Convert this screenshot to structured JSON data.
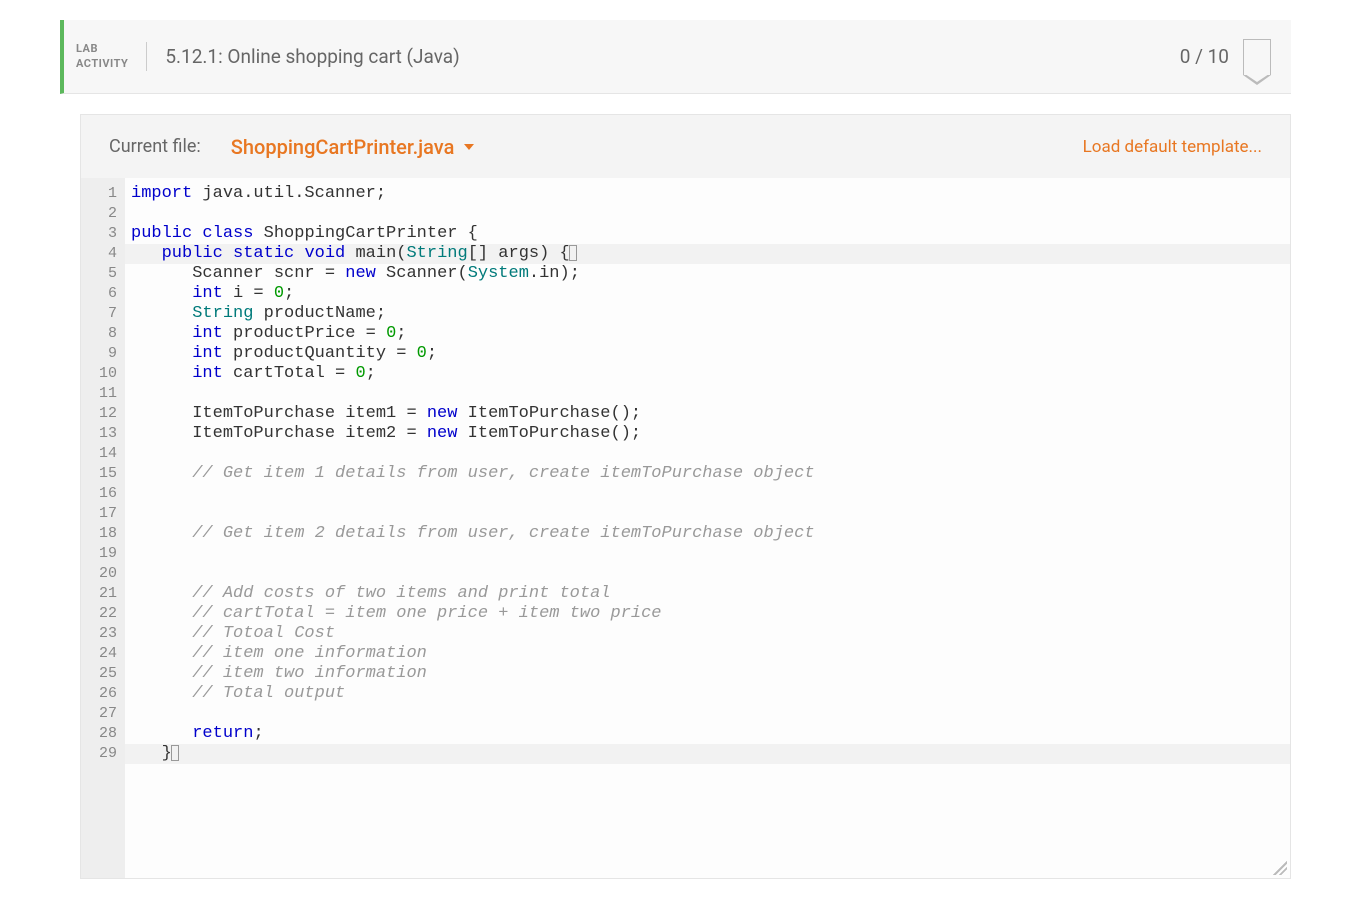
{
  "header": {
    "lab_line1": "LAB",
    "lab_line2": "ACTIVITY",
    "title": "5.12.1: Online shopping cart (Java)",
    "score": "0 / 10"
  },
  "filebar": {
    "current_file_label": "Current file:",
    "file_name": "ShoppingCartPrinter.java",
    "load_template": "Load default template..."
  },
  "code": {
    "lines": [
      {
        "n": 1,
        "t": [
          [
            "kw",
            "import"
          ],
          [
            "",
            " java.util.Scanner;"
          ]
        ]
      },
      {
        "n": 2,
        "t": []
      },
      {
        "n": 3,
        "t": [
          [
            "kw",
            "public"
          ],
          [
            "",
            " "
          ],
          [
            "kw",
            "class"
          ],
          [
            "",
            " ShoppingCartPrinter {"
          ]
        ]
      },
      {
        "n": 4,
        "t": [
          [
            "",
            "   "
          ],
          [
            "kw",
            "public"
          ],
          [
            "",
            " "
          ],
          [
            "kw",
            "static"
          ],
          [
            "",
            " "
          ],
          [
            "kw",
            "void"
          ],
          [
            "",
            " main("
          ],
          [
            "type",
            "String"
          ],
          [
            "",
            "[] args) {"
          ]
        ],
        "hl": true,
        "cursor": true
      },
      {
        "n": 5,
        "t": [
          [
            "",
            "      Scanner scnr = "
          ],
          [
            "kw",
            "new"
          ],
          [
            "",
            " Scanner("
          ],
          [
            "type",
            "System"
          ],
          [
            "",
            ".in);"
          ]
        ]
      },
      {
        "n": 6,
        "t": [
          [
            "",
            "      "
          ],
          [
            "kw",
            "int"
          ],
          [
            "",
            " i = "
          ],
          [
            "num",
            "0"
          ],
          [
            "",
            ";"
          ]
        ]
      },
      {
        "n": 7,
        "t": [
          [
            "",
            "      "
          ],
          [
            "type",
            "String"
          ],
          [
            "",
            " productName;"
          ]
        ]
      },
      {
        "n": 8,
        "t": [
          [
            "",
            "      "
          ],
          [
            "kw",
            "int"
          ],
          [
            "",
            " productPrice = "
          ],
          [
            "num",
            "0"
          ],
          [
            "",
            ";"
          ]
        ]
      },
      {
        "n": 9,
        "t": [
          [
            "",
            "      "
          ],
          [
            "kw",
            "int"
          ],
          [
            "",
            " productQuantity = "
          ],
          [
            "num",
            "0"
          ],
          [
            "",
            ";"
          ]
        ]
      },
      {
        "n": 10,
        "t": [
          [
            "",
            "      "
          ],
          [
            "kw",
            "int"
          ],
          [
            "",
            " cartTotal = "
          ],
          [
            "num",
            "0"
          ],
          [
            "",
            ";"
          ]
        ]
      },
      {
        "n": 11,
        "t": []
      },
      {
        "n": 12,
        "t": [
          [
            "",
            "      ItemToPurchase item1 = "
          ],
          [
            "kw",
            "new"
          ],
          [
            "",
            " ItemToPurchase();"
          ]
        ]
      },
      {
        "n": 13,
        "t": [
          [
            "",
            "      ItemToPurchase item2 = "
          ],
          [
            "kw",
            "new"
          ],
          [
            "",
            " ItemToPurchase();"
          ]
        ]
      },
      {
        "n": 14,
        "t": []
      },
      {
        "n": 15,
        "t": [
          [
            "",
            "      "
          ],
          [
            "cm",
            "// Get item 1 details from user, create itemToPurchase object"
          ]
        ]
      },
      {
        "n": 16,
        "t": []
      },
      {
        "n": 17,
        "t": []
      },
      {
        "n": 18,
        "t": [
          [
            "",
            "      "
          ],
          [
            "cm",
            "// Get item 2 details from user, create itemToPurchase object"
          ]
        ]
      },
      {
        "n": 19,
        "t": []
      },
      {
        "n": 20,
        "t": []
      },
      {
        "n": 21,
        "t": [
          [
            "",
            "      "
          ],
          [
            "cm",
            "// Add costs of two items and print total"
          ]
        ]
      },
      {
        "n": 22,
        "t": [
          [
            "",
            "      "
          ],
          [
            "cm",
            "// cartTotal = item one price + item two price"
          ]
        ]
      },
      {
        "n": 23,
        "t": [
          [
            "",
            "      "
          ],
          [
            "cm",
            "// Totoal Cost"
          ]
        ]
      },
      {
        "n": 24,
        "t": [
          [
            "",
            "      "
          ],
          [
            "cm",
            "// item one information"
          ]
        ]
      },
      {
        "n": 25,
        "t": [
          [
            "",
            "      "
          ],
          [
            "cm",
            "// item two information"
          ]
        ]
      },
      {
        "n": 26,
        "t": [
          [
            "",
            "      "
          ],
          [
            "cm",
            "// Total output"
          ]
        ]
      },
      {
        "n": 27,
        "t": []
      },
      {
        "n": 28,
        "t": [
          [
            "",
            "      "
          ],
          [
            "kw",
            "return"
          ],
          [
            "",
            ";"
          ]
        ]
      },
      {
        "n": 29,
        "t": [
          [
            "",
            "   }"
          ]
        ],
        "hl": true,
        "cursor": true
      }
    ]
  }
}
